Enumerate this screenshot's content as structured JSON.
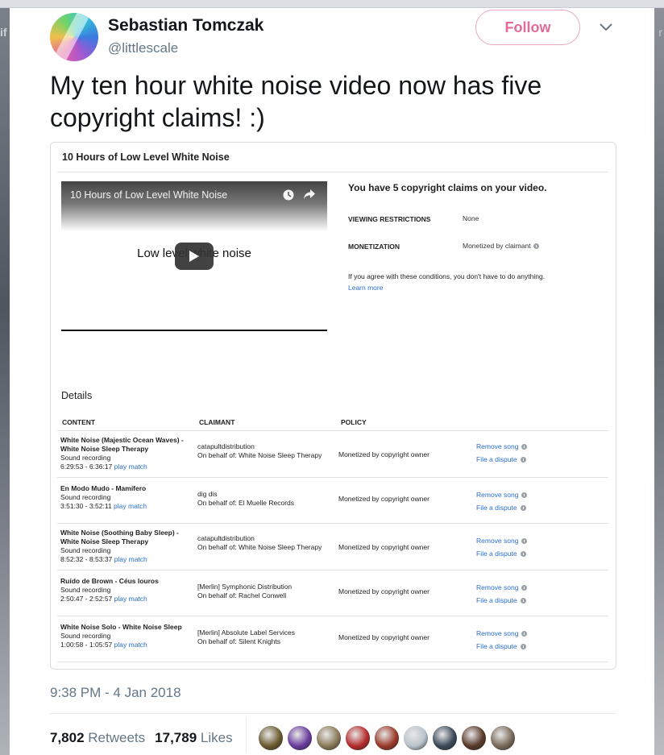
{
  "backdrop": {
    "left_edge_text": "if",
    "right_edge_text": "r"
  },
  "tweet": {
    "display_name": "Sebastian Tomczak",
    "handle": "@littlescale",
    "follow_label": "Follow",
    "text": "My ten hour white noise video now has five copyright claims! :)",
    "timestamp": "9:38 PM - 4 Jan 2018",
    "retweets_count": "7,802",
    "retweets_label": "Retweets",
    "likes_count": "17,789",
    "likes_label": "Likes",
    "liker_avatar_colors": [
      "#6b5a2e",
      "#6a3c9e",
      "#8a7a5a",
      "#b52b2b",
      "#9a3a2a",
      "#b9c2cc",
      "#3d4a5a",
      "#5a3a2a",
      "#7a6a5a"
    ]
  },
  "embed": {
    "title": "10 Hours of Low Level White Noise",
    "video": {
      "title": "10 Hours of Low Level White Noise",
      "caption": "Low level white noise"
    },
    "claims_heading": "You have 5 copyright claims on your video.",
    "viewing_restrictions_label": "VIEWING RESTRICTIONS",
    "viewing_restrictions_value": "None",
    "monetization_label": "MONETIZATION",
    "monetization_value": "Monetized by claimant",
    "agree_text": "If you agree with these conditions, you don't have to do anything.",
    "learn_more": "Learn more",
    "details_label": "Details",
    "columns": [
      "CONTENT",
      "CLAIMANT",
      "POLICY"
    ],
    "remove_song_label": "Remove song",
    "file_dispute_label": "File a dispute",
    "rows": [
      {
        "title": "White Noise (Majestic Ocean Waves) - White Noise Sleep Therapy",
        "type": "Sound recording",
        "time": "6:29:53 - 6:36:17",
        "play_match": "play match",
        "claimant": "catapultdistribution",
        "behalf": "On behalf of: White Noise Sleep Therapy",
        "policy": "Monetized by copyright owner"
      },
      {
        "title": "En Modo Mudo - Mamífero",
        "type": "Sound recording",
        "time": "3:51:30 - 3:52:11",
        "play_match": "play match",
        "claimant": "dig dis",
        "behalf": "On behalf of: El Muelle Records",
        "policy": "Monetized by copyright owner"
      },
      {
        "title": "White Noise (Soothing Baby Sleep) - White Noise Sleep Therapy",
        "type": "Sound recording",
        "time": "8:52:32 - 8:53:37",
        "play_match": "play match",
        "claimant": "catapultdistribution",
        "behalf": "On behalf of: White Noise Sleep Therapy",
        "policy": "Monetized by copyright owner"
      },
      {
        "title": "Ruído de Brown - Céus louros",
        "type": "Sound recording",
        "time": "2:50:47 - 2:52:57",
        "play_match": "play match",
        "claimant": "[Merlin] Symphonic Distribution",
        "behalf": "On behalf of: Rachel Conwell",
        "policy": "Monetized by copyright owner"
      },
      {
        "title": "White Noise Solo - White Noise Sleep",
        "type": "Sound recording",
        "time": "1:00:58 - 1:05:57",
        "play_match": "play match",
        "claimant": "[Merlin] Absolute Label Services",
        "behalf": "On behalf of: Silent Knights",
        "policy": "Monetized by copyright owner"
      }
    ]
  }
}
